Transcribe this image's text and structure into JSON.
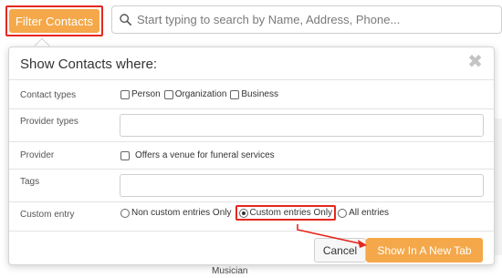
{
  "toolbar": {
    "filter_button_label": "Filter Contacts",
    "search_placeholder": "Start typing to search by Name, Address, Phone..."
  },
  "background": {
    "partial_text": "Musician"
  },
  "modal": {
    "title": "Show Contacts where:",
    "close_glyph": "✖",
    "rows": {
      "contact_types": {
        "label": "Contact types",
        "options": [
          "Person",
          "Organization",
          "Business"
        ]
      },
      "provider_types": {
        "label": "Provider types",
        "value": ""
      },
      "provider": {
        "label": "Provider",
        "option": "Offers a venue for funeral services"
      },
      "tags": {
        "label": "Tags",
        "value": ""
      },
      "custom_entry": {
        "label": "Custom entry",
        "options": [
          "Non custom entries Only",
          "Custom entries Only",
          "All entries"
        ],
        "selected": "Custom entries Only"
      }
    },
    "buttons": {
      "cancel": "Cancel",
      "show_new_tab": "Show In A New Tab"
    }
  },
  "colors": {
    "accent": "#f4a84a",
    "highlight": "#e5271e"
  }
}
